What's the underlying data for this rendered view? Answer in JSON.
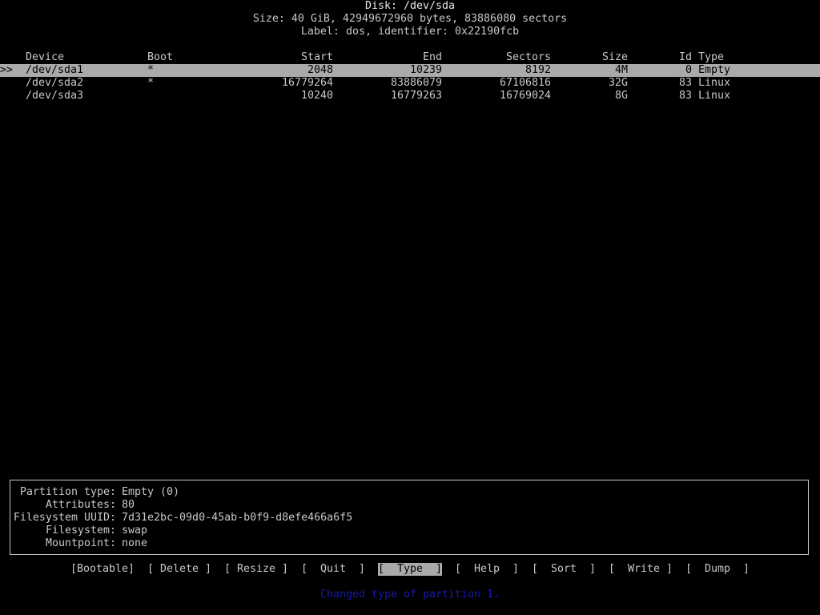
{
  "header": {
    "disk_line": "Disk: /dev/sda",
    "size_line": "Size: 40 GiB, 42949672960 bytes, 83886080 sectors",
    "label_line": "Label: dos, identifier: 0x22190fcb"
  },
  "table": {
    "columns": {
      "device": "Device",
      "boot": "Boot",
      "start": "Start",
      "end": "End",
      "sectors": "Sectors",
      "size": "Size",
      "id": "Id",
      "type": "Type"
    },
    "selection_marker": ">>",
    "rows": [
      {
        "device": "/dev/sda1",
        "boot": "*",
        "start": "2048",
        "end": "10239",
        "sectors": "8192",
        "size": "4M",
        "id": "0",
        "type": "Empty"
      },
      {
        "device": "/dev/sda2",
        "boot": "*",
        "start": "16779264",
        "end": "83886079",
        "sectors": "67106816",
        "size": "32G",
        "id": "83",
        "type": "Linux"
      },
      {
        "device": "/dev/sda3",
        "boot": "",
        "start": "10240",
        "end": "16779263",
        "sectors": "16769024",
        "size": "8G",
        "id": "83",
        "type": "Linux"
      }
    ]
  },
  "info": {
    "partition_type_key": "Partition type:",
    "partition_type_val": "Empty (0)",
    "attributes_key": "Attributes:",
    "attributes_val": "80",
    "fs_uuid_key": "Filesystem UUID:",
    "fs_uuid_val": "7d31e2bc-09d0-45ab-b0f9-d8efe466a6f5",
    "filesystem_key": "Filesystem:",
    "filesystem_val": "swap",
    "mountpoint_key": "Mountpoint:",
    "mountpoint_val": "none"
  },
  "menu": {
    "bootable": "[Bootable]",
    "delete": "[ Delete ]",
    "resize": "[ Resize ]",
    "quit": "[  Quit  ]",
    "type": "[  Type  ]",
    "help": "[  Help  ]",
    "sort": "[  Sort  ]",
    "write": "[  Write ]",
    "dump": "[  Dump  ]"
  },
  "status": {
    "message": "Changed type of partition 1."
  },
  "colors": {
    "background": "#000000",
    "text": "#c8c8c8",
    "highlight": "#aaaaaa",
    "status": "#1a1aa8"
  }
}
